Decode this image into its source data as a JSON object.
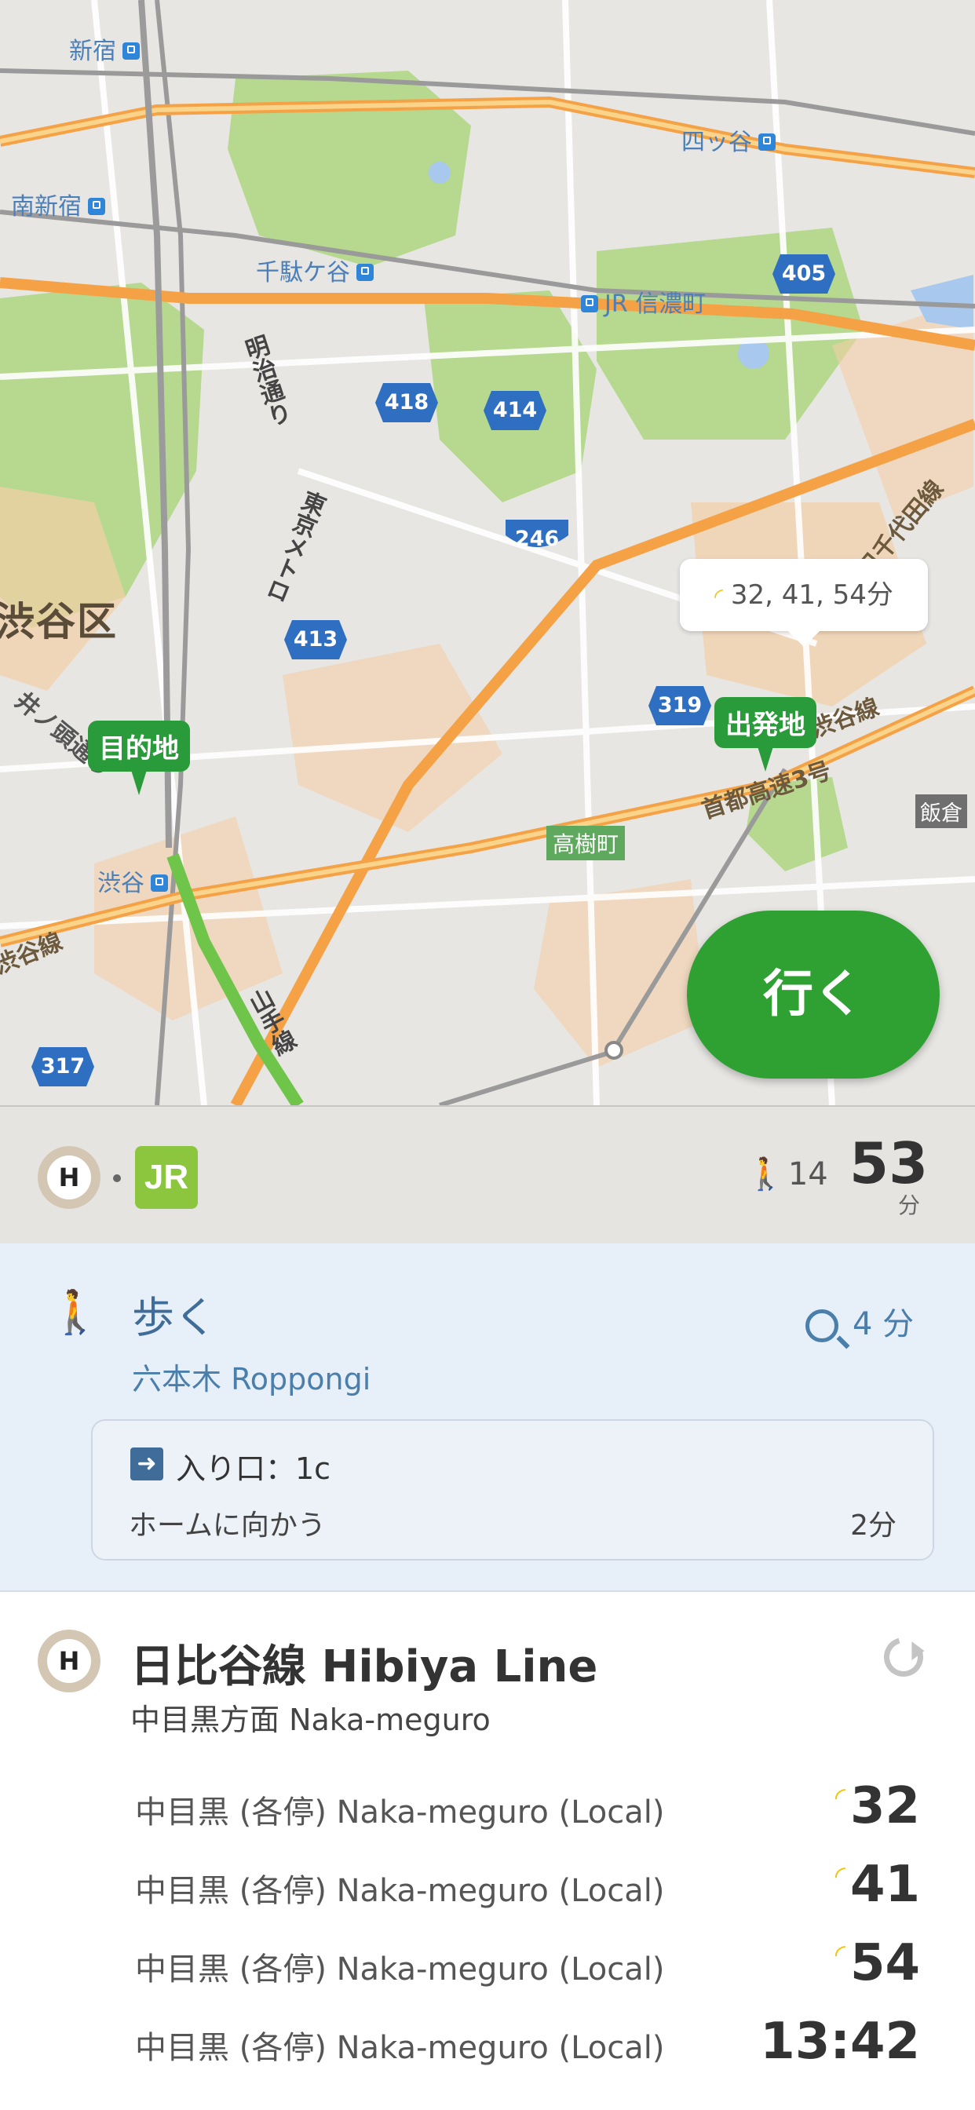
{
  "map": {
    "stations": [
      {
        "name": "新宿"
      },
      {
        "name": "四ッ谷"
      },
      {
        "name": "南新宿"
      },
      {
        "name": "千駄ケ谷"
      },
      {
        "name": "JR 信濃町"
      },
      {
        "name": "渋谷"
      }
    ],
    "district": "渋谷区",
    "routes": [
      "405",
      "418",
      "414",
      "246",
      "413",
      "319",
      "317"
    ],
    "road_labels": {
      "meiji": "明治通り",
      "tokyo_metro": "東京メトロ",
      "yamanote": "山手線",
      "chiyoda": "日千代田線",
      "shibuya_line": "渋谷線",
      "shibuya_left": "渋谷線",
      "shuto": "首都高速3号",
      "inokashira": "井ノ頭通り"
    },
    "tree_label": "高樹町",
    "grey_label": "飯倉",
    "destination_pin": "目的地",
    "origin_pin": "出発地",
    "realtime_bubble": "32, 41, 54分",
    "go_button": "行く"
  },
  "summary": {
    "line_badge": "H",
    "jr_badge": "JR",
    "walk_minutes": "14",
    "total_minutes": "53",
    "total_unit": "分"
  },
  "walk": {
    "title": "歩く",
    "station": "六本木 Roppongi",
    "minutes": "4 分",
    "entrance_label": "入り口：1c",
    "entrance_note": "ホームに向かう",
    "entrance_time": "2分"
  },
  "line": {
    "badge": "H",
    "title": "日比谷線 Hibiya Line",
    "direction": "中目黒方面 Naka-meguro",
    "departures": [
      {
        "name": "中目黒 (各停) Naka-meguro (Local)",
        "time": "32",
        "realtime": true
      },
      {
        "name": "中目黒 (各停) Naka-meguro (Local)",
        "time": "41",
        "realtime": true
      },
      {
        "name": "中目黒 (各停) Naka-meguro (Local)",
        "time": "54",
        "realtime": true
      },
      {
        "name": "中目黒 (各停) Naka-meguro (Local)",
        "time": "13:42",
        "realtime": false
      }
    ]
  },
  "colors": {
    "accent_green": "#2fa032",
    "hibiya_badge": "#d3c7b4",
    "jr_green": "#8cc63f",
    "walk_blue": "#4b7fab"
  }
}
